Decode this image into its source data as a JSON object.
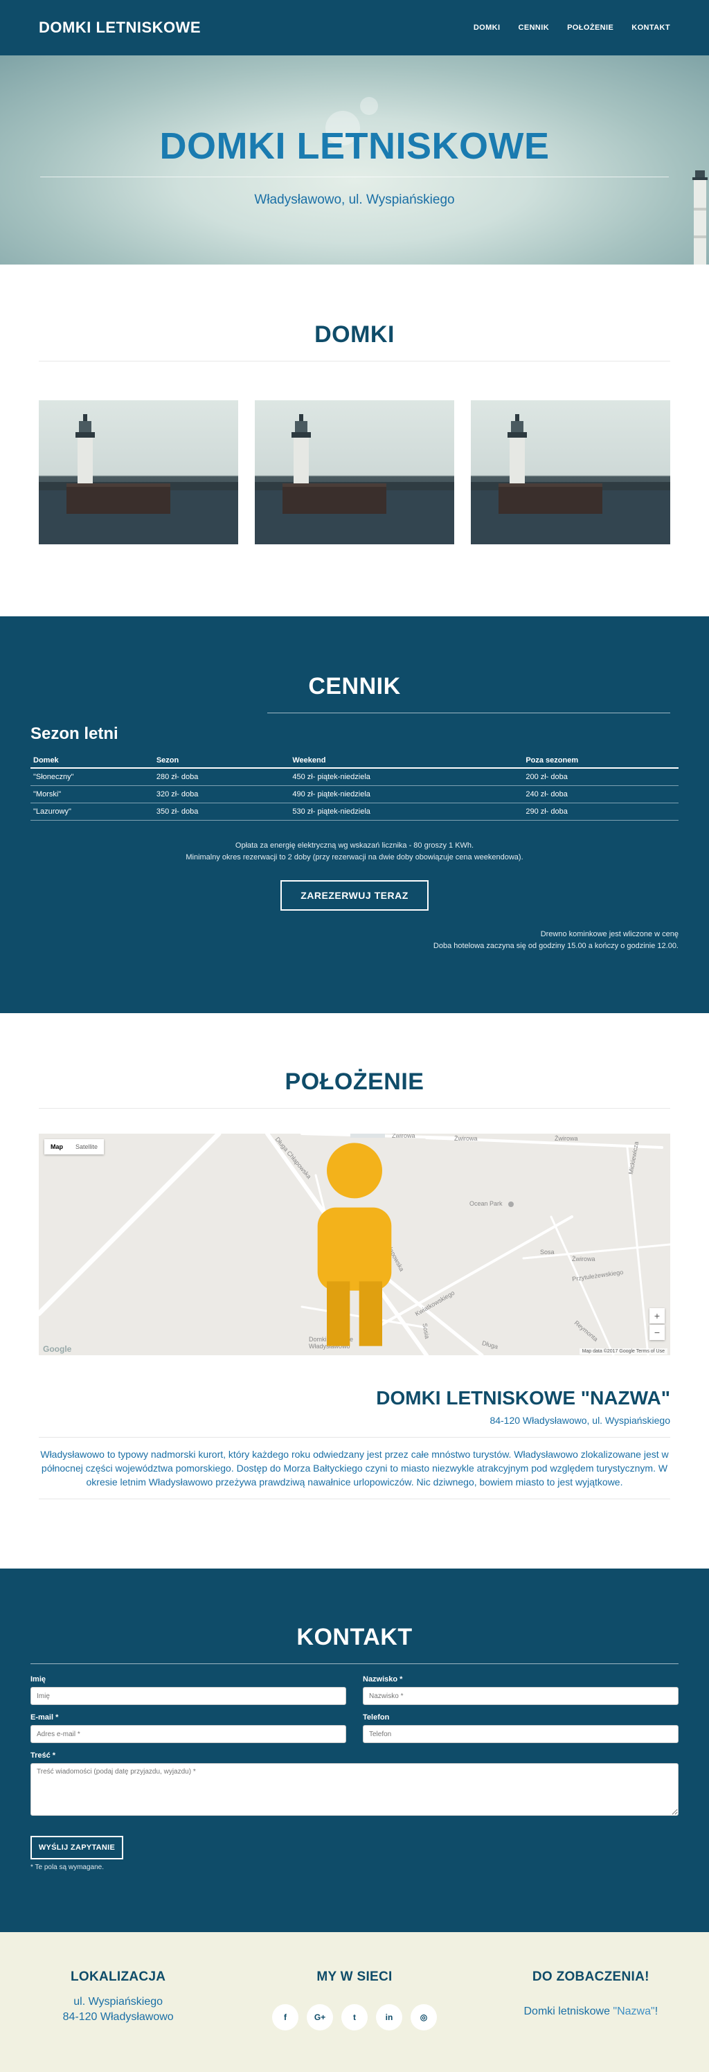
{
  "navbar": {
    "brand": "DOMKI LETNISKOWE",
    "links": [
      "DOMKI",
      "CENNIK",
      "POŁOŻENIE",
      "KONTAKT"
    ]
  },
  "hero": {
    "title": "DOMKI LETNISKOWE",
    "subtitle": "Władysławowo, ul. Wyspiańskiego"
  },
  "domki": {
    "title": "DOMKI"
  },
  "cennik": {
    "title": "CENNIK",
    "season_title": "Sezon letni",
    "columns": [
      "Domek",
      "Sezon",
      "Weekend",
      "Poza sezonem"
    ],
    "rows": [
      [
        "\"Słoneczny\"",
        "280 zł- doba",
        "450 zł- piątek-niedziela",
        "200 zł- doba"
      ],
      [
        "\"Morski\"",
        "320 zł- doba",
        "490 zł- piątek-niedziela",
        "240 zł- doba"
      ],
      [
        "\"Lazurowy\"",
        "350 zł- doba",
        "530 zł- piątek-niedziela",
        "290 zł- doba"
      ]
    ],
    "note_line1": "Opłata za energię elektryczną wg wskazań licznika - 80 groszy 1 KWh.",
    "note_line2": "Minimalny okres rezerwacji to 2 doby (przy rezerwacji na dwie doby obowiązuje cena weekendowa).",
    "reserve_label": "ZAREZERWUJ TERAZ",
    "right_note1": "Drewno kominkowe jest wliczone w cenę",
    "right_note2": "Doba hotelowa zaczyna się od godziny 15.00 a kończy o godzinie 12.00."
  },
  "polozenie": {
    "title": "POŁOŻENIE",
    "map": {
      "toggle_map": "Map",
      "toggle_satellite": "Satellite",
      "zoom_in": "+",
      "zoom_out": "−",
      "google": "Google",
      "attribution": "Map data ©2017 Google    Terms of Use",
      "labels": {
        "street_1": "Żwirowa",
        "street_2": "Żwirowa",
        "street_3": "Żwirowa",
        "street_4": "Długa Chłapowska",
        "street_5": "Długa Chłapowska",
        "park": "Ocean Park",
        "street_6": "Przytuleżewskiego",
        "street_7": "Sosia",
        "street_8": "Kwiatkowskiego",
        "street_9": "Reymonta",
        "street_10": "Mickiewicza",
        "place": "Domki Bałtyckie Władysławowo",
        "street_11": "Długa",
        "street_12": "Żwirowa",
        "street_13": "Sosa"
      }
    },
    "poi_title": "DOMKI LETNISKOWE \"NAZWA\"",
    "poi_address": "84-120 Władysławowo, ul. Wyspiańskiego",
    "description": "Władysławowo to typowy nadmorski kurort, który każdego roku odwiedzany jest przez całe mnóstwo turystów. Władysławowo zlokalizowane jest w północnej części województwa pomorskiego. Dostęp do Morza Bałtyckiego czyni to miasto niezwykle atrakcyjnym pod względem turystycznym. W okresie letnim Władysławowo przeżywa prawdziwą nawałnice urlopowiczów. Nic dziwnego, bowiem miasto to jest wyjątkowe."
  },
  "kontakt": {
    "title": "KONTAKT",
    "first_name_label": "Imię",
    "first_name_placeholder": "Imię",
    "last_name_label": "Nazwisko *",
    "last_name_placeholder": "Nazwisko *",
    "email_label": "E-mail *",
    "email_placeholder": "Adres e-mail *",
    "phone_label": "Telefon",
    "phone_placeholder": "Telefon",
    "message_label": "Treść *",
    "message_placeholder": "Treść wiadomości (podaj datę przyjazdu, wyjazdu) *",
    "send_label": "WYŚLIJ ZAPYTANIE",
    "required_note": "* Te pola są wymagane."
  },
  "footer": {
    "location_title": "LOKALIZACJA",
    "location_line1": "ul. Wyspiańskiego",
    "location_line2": "84-120 Władysławowo",
    "social_title": "MY W SIECI",
    "socials": [
      "f",
      "G+",
      "t",
      "in",
      "◎"
    ],
    "goodbye_title": "DO ZOBACZENIA!",
    "goodbye_text": "Domki letniskowe ",
    "goodbye_name": "\"Nazwa\"",
    "goodbye_end": "!"
  },
  "colors": {
    "primary_dark": "#0f4c69",
    "accent_blue": "#1a6fa5",
    "footer_bg": "#f1f1e1",
    "map_pin": "#c0161a"
  }
}
